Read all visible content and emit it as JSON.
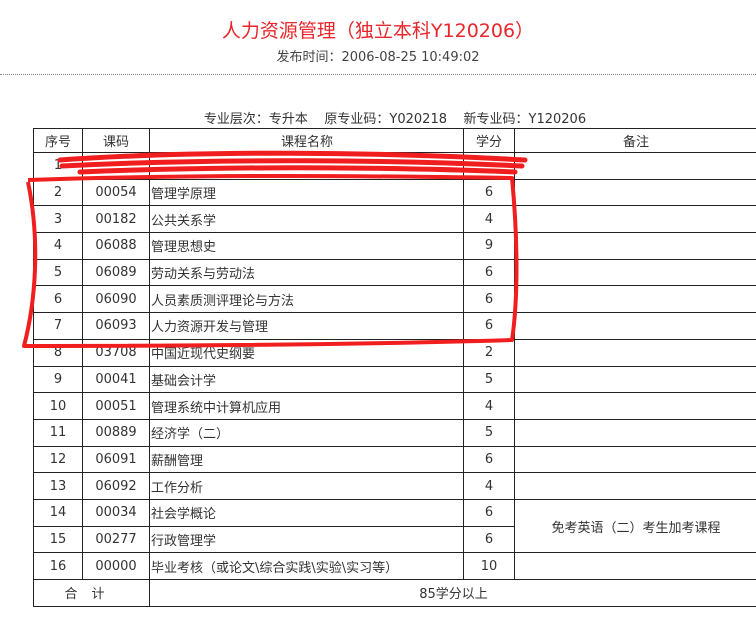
{
  "header": {
    "title": "人力资源管理（独立本科Y120206）",
    "publish_time": "发布时间：2006-08-25 10:49:02"
  },
  "meta": {
    "level": "专业层次：专升本",
    "old_code": "原专业码：Y020218",
    "new_code": "新专业码：Y120206"
  },
  "table": {
    "headers": [
      "序号",
      "课码",
      "课程名称",
      "学分",
      "备注"
    ],
    "rows": [
      {
        "seq": "1",
        "code": "",
        "name": "",
        "credit": ""
      },
      {
        "seq": "2",
        "code": "00054",
        "name": "管理学原理",
        "credit": "6"
      },
      {
        "seq": "3",
        "code": "00182",
        "name": "公共关系学",
        "credit": "4"
      },
      {
        "seq": "4",
        "code": "06088",
        "name": "管理思想史",
        "credit": "9"
      },
      {
        "seq": "5",
        "code": "06089",
        "name": "劳动关系与劳动法",
        "credit": "6"
      },
      {
        "seq": "6",
        "code": "06090",
        "name": "人员素质测评理论与方法",
        "credit": "6"
      },
      {
        "seq": "7",
        "code": "06093",
        "name": "人力资源开发与管理",
        "credit": "6"
      },
      {
        "seq": "8",
        "code": "03708",
        "name": "中国近现代史纲要",
        "credit": "2"
      },
      {
        "seq": "9",
        "code": "00041",
        "name": "基础会计学",
        "credit": "5"
      },
      {
        "seq": "10",
        "code": "00051",
        "name": "管理系统中计算机应用",
        "credit": "4"
      },
      {
        "seq": "11",
        "code": "00889",
        "name": "经济学（二）",
        "credit": "5"
      },
      {
        "seq": "12",
        "code": "06091",
        "name": "薪酬管理",
        "credit": "6"
      },
      {
        "seq": "13",
        "code": "06092",
        "name": "工作分析",
        "credit": "4"
      },
      {
        "seq": "14",
        "code": "00034",
        "name": "社会学概论",
        "credit": "6"
      },
      {
        "seq": "15",
        "code": "00277",
        "name": "行政管理学",
        "credit": "6"
      },
      {
        "seq": "16",
        "code": "00000",
        "name": "毕业考核（或论文\\综合实践\\实验\\实习等）",
        "credit": "10"
      }
    ],
    "note_14_15": "免考英语（二）考生加考课程",
    "total_label": "合计",
    "total_value": "85学分以上"
  },
  "annotation": {
    "color": "#f01e1e"
  }
}
